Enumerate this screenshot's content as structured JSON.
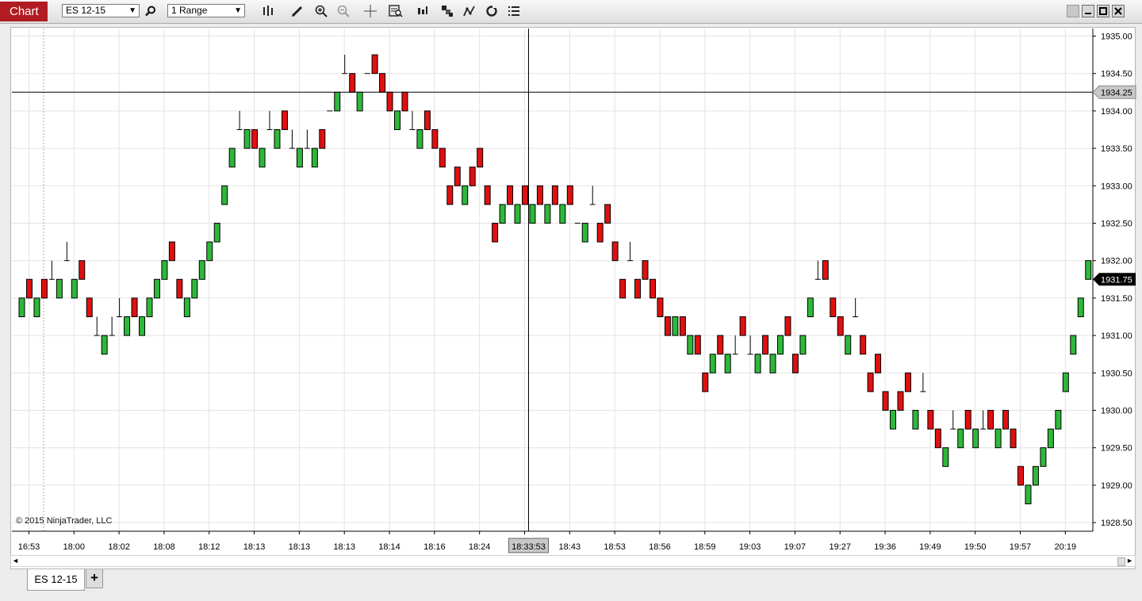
{
  "toolbar": {
    "chart_label": "Chart",
    "instrument_value": "ES 12-15",
    "bar_type_value": "1 Range",
    "icons": [
      "search-icon",
      "bar-style-icon",
      "draw-pencil-icon",
      "zoom-in-icon",
      "zoom-out-icon",
      "crosshair-icon",
      "data-box-icon",
      "indicators-icon",
      "strategies-icon",
      "drawing-tools-icon",
      "reload-icon",
      "properties-icon"
    ]
  },
  "window_buttons": [
    "restore-icon",
    "minimize-icon",
    "maximize-icon",
    "close-icon"
  ],
  "chart_data": {
    "type": "candlestick",
    "instrument": "ES 12-15",
    "bar_type": "1 Range",
    "ylim": [
      1928.5,
      1935.0
    ],
    "y_ticks": [
      "1935.00",
      "1934.50",
      "1934.00",
      "1933.50",
      "1933.00",
      "1932.50",
      "1932.00",
      "1931.50",
      "1931.00",
      "1930.50",
      "1930.00",
      "1929.50",
      "1929.00",
      "1928.50"
    ],
    "x_tick_labels": [
      "16:53",
      "18:00",
      "18:02",
      "18:08",
      "18:12",
      "18:13",
      "18:13",
      "18:13",
      "18:14",
      "18:16",
      "18:24",
      "18:33:53",
      "18:43",
      "18:53",
      "18:56",
      "18:59",
      "19:03",
      "19:07",
      "19:27",
      "19:36",
      "19:49",
      "19:50",
      "19:57",
      "20:19"
    ],
    "x_tick_bars": [
      1,
      7,
      13,
      19,
      25,
      31,
      37,
      43,
      49,
      55,
      61,
      67,
      73,
      79,
      85,
      91,
      97,
      103,
      109,
      115,
      121,
      127,
      133,
      139
    ],
    "hover_label": "18:33:53",
    "crosshair_price": "1934.25",
    "last_price": "1931.75",
    "colors": {
      "up": "#2eb83a",
      "down": "#e01010",
      "dash": "#000000",
      "grid": "#e3e3e3",
      "last_price_bg": "#000000",
      "crosshair_label_bg": "#c8c8c8"
    },
    "ohlc": [
      [
        1931.25,
        1931.5,
        1931.25,
        1931.5
      ],
      [
        1931.75,
        1931.75,
        1931.5,
        1931.5
      ],
      [
        1931.25,
        1931.5,
        1931.25,
        1931.5
      ],
      [
        1931.75,
        1931.75,
        1931.5,
        1931.5
      ],
      [
        1931.75,
        1932.0,
        1931.75,
        1931.75
      ],
      [
        1931.5,
        1931.75,
        1931.5,
        1931.75
      ],
      [
        1932.0,
        1932.25,
        1932.0,
        1932.0
      ],
      [
        1931.5,
        1931.75,
        1931.5,
        1931.75
      ],
      [
        1932.0,
        1932.0,
        1931.75,
        1931.75
      ],
      [
        1931.5,
        1931.5,
        1931.25,
        1931.25
      ],
      [
        1931.0,
        1931.25,
        1931.0,
        1931.0
      ],
      [
        1930.75,
        1931.0,
        1930.75,
        1931.0
      ],
      [
        1931.0,
        1931.25,
        1931.0,
        1931.0
      ],
      [
        1931.25,
        1931.5,
        1931.25,
        1931.25
      ],
      [
        1931.0,
        1931.25,
        1931.0,
        1931.25
      ],
      [
        1931.5,
        1931.5,
        1931.25,
        1931.25
      ],
      [
        1931.0,
        1931.25,
        1931.0,
        1931.25
      ],
      [
        1931.25,
        1931.5,
        1931.25,
        1931.5
      ],
      [
        1931.5,
        1931.75,
        1931.5,
        1931.75
      ],
      [
        1931.75,
        1932.0,
        1931.75,
        1932.0
      ],
      [
        1932.25,
        1932.25,
        1932.0,
        1932.0
      ],
      [
        1931.75,
        1931.75,
        1931.5,
        1931.5
      ],
      [
        1931.25,
        1931.5,
        1931.25,
        1931.5
      ],
      [
        1931.5,
        1931.75,
        1931.5,
        1931.75
      ],
      [
        1931.75,
        1932.0,
        1931.75,
        1932.0
      ],
      [
        1932.0,
        1932.25,
        1932.0,
        1932.25
      ],
      [
        1932.25,
        1932.5,
        1932.25,
        1932.5
      ],
      [
        1932.75,
        1933.0,
        1932.75,
        1933.0
      ],
      [
        1933.25,
        1933.5,
        1933.25,
        1933.5
      ],
      [
        1933.75,
        1934.0,
        1933.75,
        1933.75
      ],
      [
        1933.5,
        1933.75,
        1933.5,
        1933.75
      ],
      [
        1933.75,
        1933.75,
        1933.5,
        1933.5
      ],
      [
        1933.25,
        1933.5,
        1933.25,
        1933.5
      ],
      [
        1933.75,
        1934.0,
        1933.75,
        1933.75
      ],
      [
        1933.5,
        1933.75,
        1933.5,
        1933.75
      ],
      [
        1934.0,
        1934.0,
        1933.75,
        1933.75
      ],
      [
        1933.5,
        1933.75,
        1933.5,
        1933.5
      ],
      [
        1933.25,
        1933.5,
        1933.25,
        1933.5
      ],
      [
        1933.5,
        1933.75,
        1933.5,
        1933.5
      ],
      [
        1933.25,
        1933.5,
        1933.25,
        1933.5
      ],
      [
        1933.75,
        1933.75,
        1933.5,
        1933.5
      ],
      [
        1934.0,
        1934.0,
        1934.0,
        1934.0
      ],
      [
        1934.0,
        1934.25,
        1934.0,
        1934.25
      ],
      [
        1934.5,
        1934.75,
        1934.5,
        1934.5
      ],
      [
        1934.5,
        1934.5,
        1934.25,
        1934.25
      ],
      [
        1934.0,
        1934.25,
        1934.0,
        1934.25
      ],
      [
        1934.5,
        1934.5,
        1934.5,
        1934.5
      ],
      [
        1934.75,
        1934.75,
        1934.5,
        1934.5
      ],
      [
        1934.5,
        1934.5,
        1934.25,
        1934.25
      ],
      [
        1934.25,
        1934.25,
        1934.0,
        1934.0
      ],
      [
        1933.75,
        1934.0,
        1933.75,
        1934.0
      ],
      [
        1934.25,
        1934.25,
        1934.0,
        1934.0
      ],
      [
        1933.75,
        1934.0,
        1933.75,
        1933.75
      ],
      [
        1933.5,
        1933.75,
        1933.5,
        1933.75
      ],
      [
        1934.0,
        1934.0,
        1933.75,
        1933.75
      ],
      [
        1933.75,
        1933.75,
        1933.5,
        1933.5
      ],
      [
        1933.5,
        1933.5,
        1933.25,
        1933.25
      ],
      [
        1933.0,
        1933.0,
        1932.75,
        1932.75
      ],
      [
        1933.25,
        1933.25,
        1933.0,
        1933.0
      ],
      [
        1932.75,
        1933.0,
        1932.75,
        1933.0
      ],
      [
        1933.25,
        1933.25,
        1933.0,
        1933.0
      ],
      [
        1933.5,
        1933.5,
        1933.25,
        1933.25
      ],
      [
        1933.0,
        1933.0,
        1932.75,
        1932.75
      ],
      [
        1932.5,
        1932.5,
        1932.25,
        1932.25
      ],
      [
        1932.5,
        1932.75,
        1932.5,
        1932.75
      ],
      [
        1933.0,
        1933.0,
        1932.75,
        1932.75
      ],
      [
        1932.5,
        1932.75,
        1932.5,
        1932.75
      ],
      [
        1933.0,
        1933.0,
        1932.75,
        1932.75
      ],
      [
        1932.5,
        1932.75,
        1932.5,
        1932.75
      ],
      [
        1933.0,
        1933.0,
        1932.75,
        1932.75
      ],
      [
        1932.5,
        1932.75,
        1932.5,
        1932.75
      ],
      [
        1933.0,
        1933.0,
        1932.75,
        1932.75
      ],
      [
        1932.5,
        1932.75,
        1932.5,
        1932.75
      ],
      [
        1933.0,
        1933.0,
        1932.75,
        1932.75
      ],
      [
        1932.5,
        1932.5,
        1932.5,
        1932.5
      ],
      [
        1932.25,
        1932.5,
        1932.25,
        1932.5
      ],
      [
        1932.75,
        1933.0,
        1932.75,
        1932.75
      ],
      [
        1932.5,
        1932.5,
        1932.25,
        1932.25
      ],
      [
        1932.75,
        1932.75,
        1932.5,
        1932.5
      ],
      [
        1932.25,
        1932.25,
        1932.0,
        1932.0
      ],
      [
        1931.75,
        1931.75,
        1931.5,
        1931.5
      ],
      [
        1932.0,
        1932.25,
        1932.0,
        1932.0
      ],
      [
        1931.75,
        1931.75,
        1931.5,
        1931.5
      ],
      [
        1932.0,
        1932.0,
        1931.75,
        1931.75
      ],
      [
        1931.75,
        1931.75,
        1931.5,
        1931.5
      ],
      [
        1931.5,
        1931.5,
        1931.25,
        1931.25
      ],
      [
        1931.25,
        1931.25,
        1931.0,
        1931.0
      ],
      [
        1931.0,
        1931.25,
        1931.0,
        1931.25
      ],
      [
        1931.25,
        1931.25,
        1931.0,
        1931.0
      ],
      [
        1930.75,
        1931.0,
        1930.75,
        1931.0
      ],
      [
        1931.0,
        1931.0,
        1930.75,
        1930.75
      ],
      [
        1930.5,
        1930.5,
        1930.25,
        1930.25
      ],
      [
        1930.5,
        1930.75,
        1930.5,
        1930.75
      ],
      [
        1931.0,
        1931.0,
        1930.75,
        1930.75
      ],
      [
        1930.5,
        1930.75,
        1930.5,
        1930.75
      ],
      [
        1930.75,
        1931.0,
        1930.75,
        1930.75
      ],
      [
        1931.25,
        1931.25,
        1931.0,
        1931.0
      ],
      [
        1930.75,
        1931.0,
        1930.75,
        1930.75
      ],
      [
        1930.5,
        1930.75,
        1930.5,
        1930.75
      ],
      [
        1931.0,
        1931.0,
        1930.75,
        1930.75
      ],
      [
        1930.5,
        1930.75,
        1930.5,
        1930.75
      ],
      [
        1930.75,
        1931.0,
        1930.75,
        1931.0
      ],
      [
        1931.25,
        1931.25,
        1931.0,
        1931.0
      ],
      [
        1930.75,
        1930.75,
        1930.5,
        1930.5
      ],
      [
        1930.75,
        1931.0,
        1930.75,
        1931.0
      ],
      [
        1931.25,
        1931.5,
        1931.25,
        1931.5
      ],
      [
        1931.75,
        1932.0,
        1931.75,
        1931.75
      ],
      [
        1932.0,
        1932.0,
        1931.75,
        1931.75
      ],
      [
        1931.5,
        1931.5,
        1931.25,
        1931.25
      ],
      [
        1931.25,
        1931.25,
        1931.0,
        1931.0
      ],
      [
        1930.75,
        1931.0,
        1930.75,
        1931.0
      ],
      [
        1931.25,
        1931.5,
        1931.25,
        1931.25
      ],
      [
        1931.0,
        1931.0,
        1930.75,
        1930.75
      ],
      [
        1930.5,
        1930.5,
        1930.25,
        1930.25
      ],
      [
        1930.75,
        1930.75,
        1930.5,
        1930.5
      ],
      [
        1930.25,
        1930.25,
        1930.0,
        1930.0
      ],
      [
        1929.75,
        1930.0,
        1929.75,
        1930.0
      ],
      [
        1930.25,
        1930.25,
        1930.0,
        1930.0
      ],
      [
        1930.5,
        1930.5,
        1930.25,
        1930.25
      ],
      [
        1929.75,
        1930.0,
        1929.75,
        1930.0
      ],
      [
        1930.25,
        1930.5,
        1930.25,
        1930.25
      ],
      [
        1930.0,
        1930.0,
        1929.75,
        1929.75
      ],
      [
        1929.75,
        1929.75,
        1929.5,
        1929.5
      ],
      [
        1929.25,
        1929.5,
        1929.25,
        1929.5
      ],
      [
        1929.75,
        1930.0,
        1929.75,
        1929.75
      ],
      [
        1929.5,
        1929.75,
        1929.5,
        1929.75
      ],
      [
        1930.0,
        1930.0,
        1929.75,
        1929.75
      ],
      [
        1929.5,
        1929.75,
        1929.5,
        1929.75
      ],
      [
        1929.75,
        1930.0,
        1929.75,
        1929.75
      ],
      [
        1930.0,
        1930.0,
        1929.75,
        1929.75
      ],
      [
        1929.5,
        1929.75,
        1929.5,
        1929.75
      ],
      [
        1930.0,
        1930.0,
        1929.75,
        1929.75
      ],
      [
        1929.75,
        1929.75,
        1929.5,
        1929.5
      ],
      [
        1929.25,
        1929.25,
        1929.0,
        1929.0
      ],
      [
        1928.75,
        1929.0,
        1928.75,
        1929.0
      ],
      [
        1929.0,
        1929.25,
        1929.0,
        1929.25
      ],
      [
        1929.25,
        1929.5,
        1929.25,
        1929.5
      ],
      [
        1929.5,
        1929.75,
        1929.5,
        1929.75
      ],
      [
        1929.75,
        1930.0,
        1929.75,
        1930.0
      ],
      [
        1930.25,
        1930.5,
        1930.25,
        1930.5
      ],
      [
        1930.75,
        1931.0,
        1930.75,
        1931.0
      ],
      [
        1931.25,
        1931.5,
        1931.25,
        1931.5
      ],
      [
        1931.75,
        1932.0,
        1931.75,
        1932.0
      ]
    ]
  },
  "copyright": "© 2015 NinjaTrader, LLC",
  "tabs": {
    "active": "ES 12-15",
    "add": "+"
  }
}
